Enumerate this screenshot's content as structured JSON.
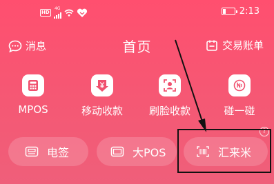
{
  "statusbar": {
    "network_badge": "HD",
    "signal_gen": "4G",
    "time": "2:13"
  },
  "header": {
    "messages_label": "消息",
    "title": "首页",
    "bills_label": "交易账单"
  },
  "quick_actions": [
    {
      "label": "MPOS",
      "icon": "calculator-icon"
    },
    {
      "label": "移动收款",
      "icon": "yuan-download-icon"
    },
    {
      "label": "刷脸收款",
      "icon": "face-scan-icon"
    },
    {
      "label": "碰一碰",
      "icon": "nfc-icon"
    }
  ],
  "services": [
    {
      "label": "电签",
      "icon": "pos-terminal-icon"
    },
    {
      "label": "大POS",
      "icon": "pos-device-icon"
    },
    {
      "label": "汇来米",
      "icon": "barcode-scan-icon"
    }
  ],
  "help_glyph": "?",
  "colors": {
    "background": "#f55874",
    "accent_icon": "#f0506e",
    "highlight_border": "#111111"
  }
}
